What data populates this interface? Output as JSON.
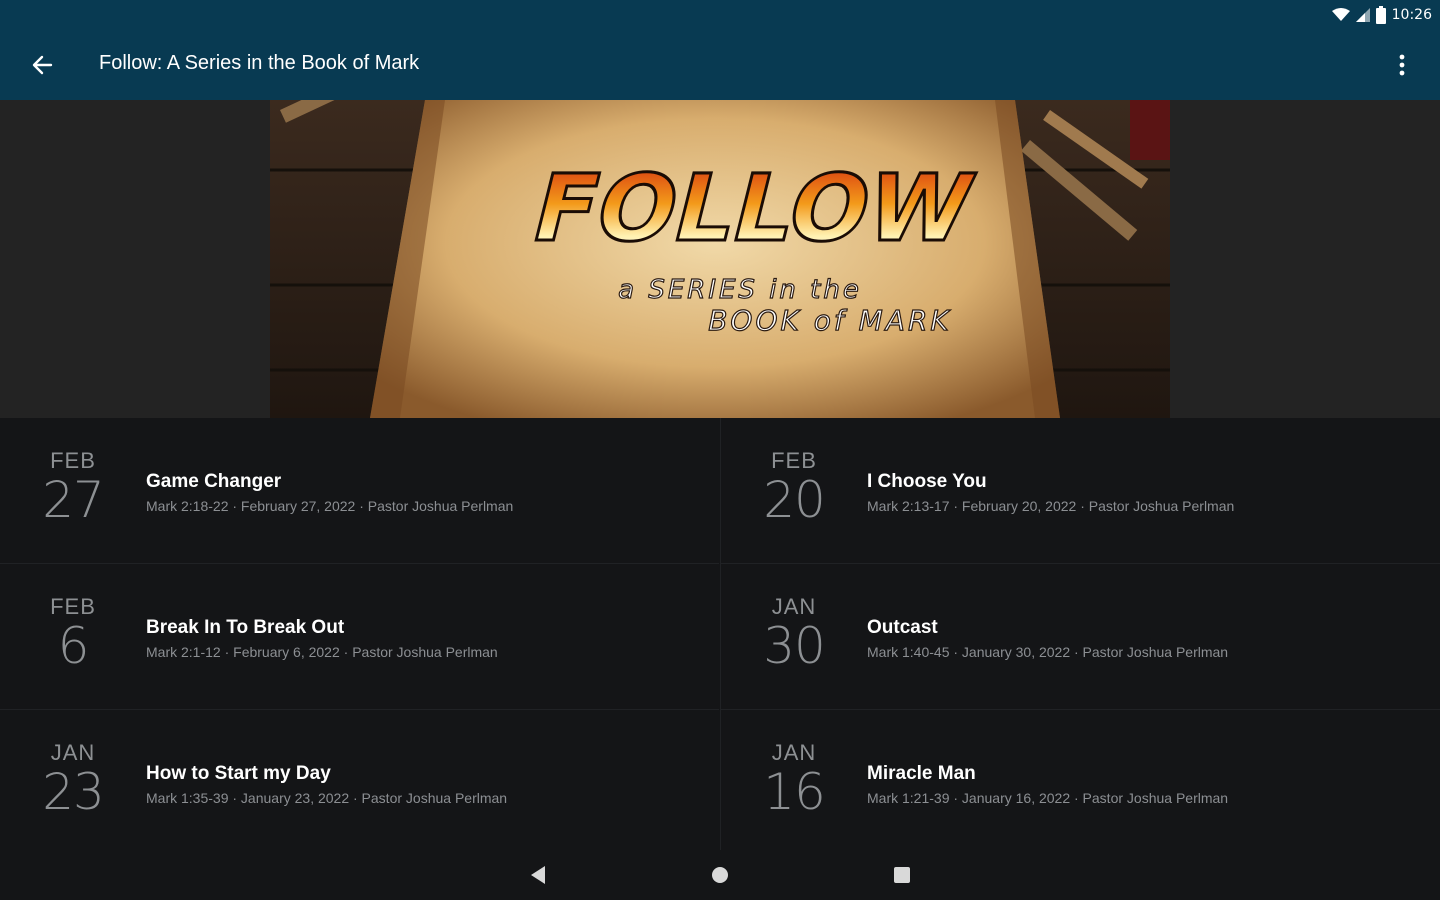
{
  "status_bar": {
    "time": "10:26",
    "icons": [
      "wifi-icon",
      "cellular-signal-icon",
      "battery-icon"
    ]
  },
  "app_bar": {
    "title": "Follow: A Series in the Book of Mark",
    "back_icon": "arrow-back-icon",
    "menu_icon": "more-vert-icon",
    "color": "#083a52"
  },
  "banner": {
    "headline": "FOLLOW",
    "subtitle_line1": "a SERIES in the",
    "subtitle_line2": "BOOK of MARK"
  },
  "sermons": [
    {
      "month": "FEB",
      "day": "27",
      "title": "Game Changer",
      "meta": "Mark 2:18-22 · February 27, 2022 · Pastor Joshua Perlman"
    },
    {
      "month": "FEB",
      "day": "20",
      "title": "I Choose You",
      "meta": "Mark 2:13-17 · February 20, 2022 · Pastor Joshua Perlman"
    },
    {
      "month": "FEB",
      "day": "6",
      "title": "Break In To Break Out",
      "meta": "Mark 2:1-12 · February 6, 2022 · Pastor Joshua Perlman"
    },
    {
      "month": "JAN",
      "day": "30",
      "title": "Outcast",
      "meta": "Mark 1:40-45 · January 30, 2022 · Pastor Joshua Perlman"
    },
    {
      "month": "JAN",
      "day": "23",
      "title": "How to Start my Day",
      "meta": "Mark 1:35-39 · January 23, 2022 · Pastor Joshua Perlman"
    },
    {
      "month": "JAN",
      "day": "16",
      "title": "Miracle Man",
      "meta": "Mark 1:21-39 · January 16, 2022 · Pastor Joshua Perlman"
    }
  ],
  "nav_bar": {
    "icons": [
      "back-triangle-icon",
      "home-circle-icon",
      "recents-square-icon"
    ]
  }
}
